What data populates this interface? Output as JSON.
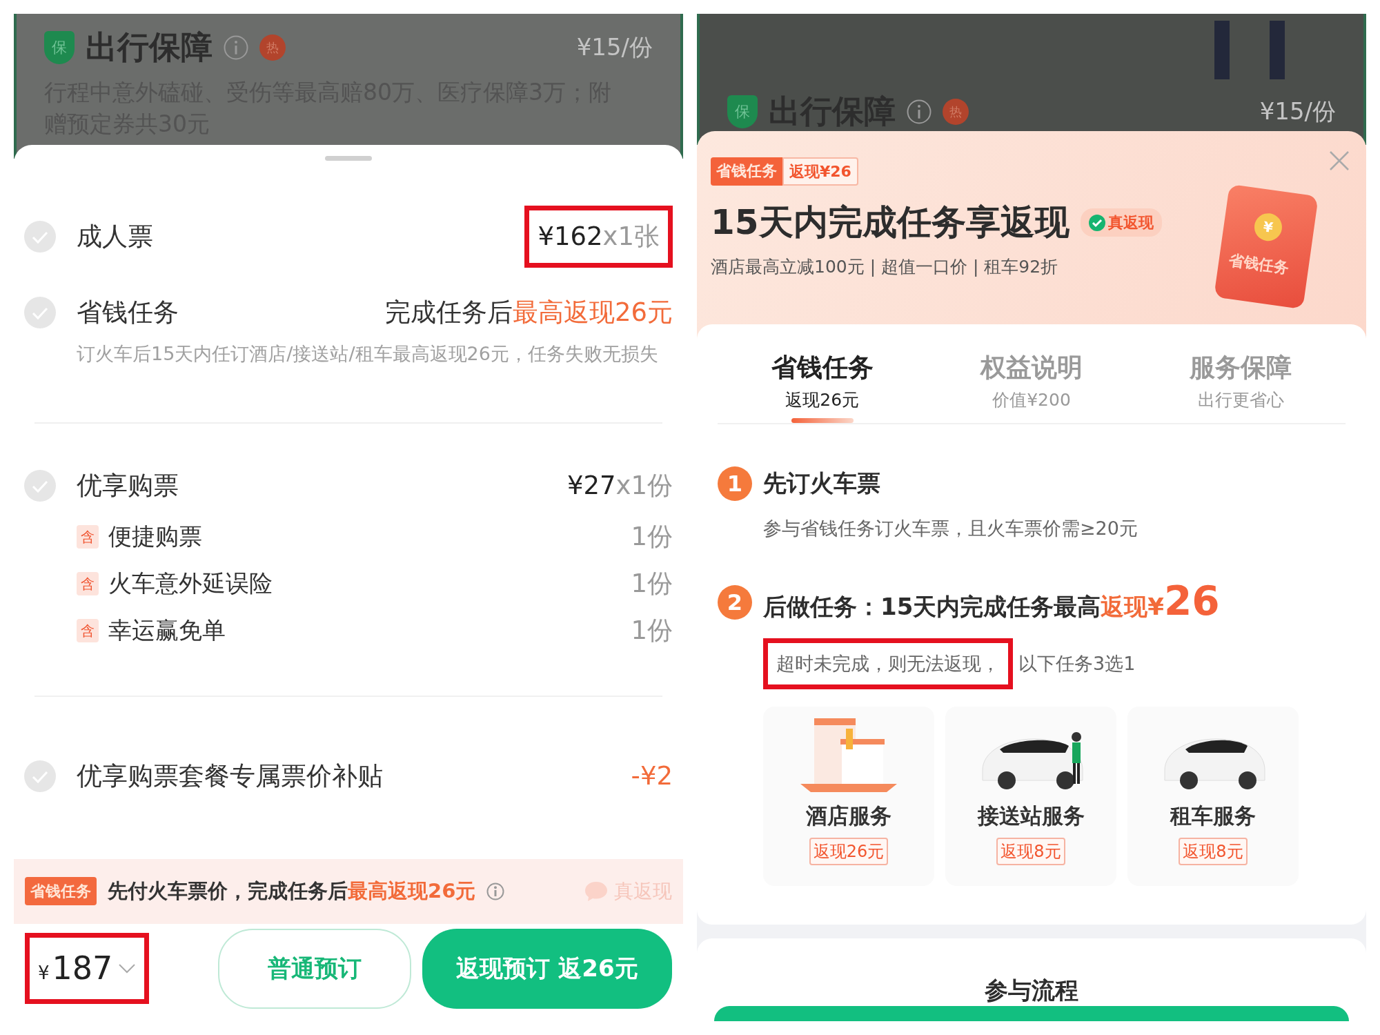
{
  "left_screen": {
    "background_card": {
      "shield": "保",
      "title": "出行保障",
      "badge": "热",
      "price": "¥15/份",
      "description": "行程中意外磕碰、受伤等最高赔80万、医疗保障3万；附赠预定券共30元"
    },
    "items": [
      {
        "kind": "line",
        "label": "成人票",
        "price": "¥162",
        "quantity": "x1张",
        "highlighted": true
      },
      {
        "kind": "task",
        "label": "省钱任务",
        "value": "完成任务后",
        "value_highlight": "最高返现26元",
        "note": "订火车后15天内任订酒店/接送站/租车最高返现26元，任务失败无损失"
      },
      {
        "kind": "package",
        "label": "优享购票",
        "price": "¥27",
        "quantity": "x1份",
        "includes": [
          {
            "tag": "含",
            "name": "便捷购票",
            "quantity": "1份"
          },
          {
            "tag": "含",
            "name": "火车意外延误险",
            "quantity": "1份"
          },
          {
            "tag": "含",
            "name": "幸运赢免单",
            "quantity": "1份"
          }
        ]
      },
      {
        "kind": "discount",
        "label": "优享购票套餐专属票价补贴",
        "amount": "-¥2"
      }
    ],
    "promo": {
      "tag": "省钱任务",
      "text": "先付火车票价，完成任务后",
      "highlight": "最高返现26元",
      "stamp": "真返现"
    },
    "footer": {
      "currency": "¥",
      "total": "187",
      "highlighted": true,
      "buttons": [
        {
          "kind": "outline",
          "label": "普通预订"
        },
        {
          "kind": "primary",
          "label": "返现预订 返26元"
        }
      ]
    }
  },
  "right_screen": {
    "background_card": {
      "shield": "保",
      "title": "出行保障",
      "badge": "热",
      "price": "¥15/份"
    },
    "header": {
      "tag": "省钱任务",
      "tag_value": "返现¥26",
      "title": "15天内完成任务享返现",
      "stamp": "真返现",
      "subtitle": "酒店最高立减100元 | 超值一口价 | 租车92折",
      "envelope_label": "省钱任务",
      "envelope_coin": "¥"
    },
    "tabs": [
      {
        "title": "省钱任务",
        "subtitle": "返现26元",
        "selected": true
      },
      {
        "title": "权益说明",
        "subtitle": "价值¥200",
        "selected": false
      },
      {
        "title": "服务保障",
        "subtitle": "出行更省心",
        "selected": false
      }
    ],
    "steps": [
      {
        "number": "1",
        "title": "先订火车票",
        "description": [
          {
            "text": "参与省钱任务订火车票，且火车票价需≥20元",
            "highlighted": false
          }
        ]
      },
      {
        "number": "2",
        "title": "后做任务：15天内完成任务最高",
        "title_highlight": "返现¥",
        "title_amount": "26",
        "description": [
          {
            "text": "超时未完成，则无法返现，",
            "highlighted": true
          },
          {
            "text": "以下任务3选1",
            "highlighted": false
          }
        ]
      }
    ],
    "services": [
      {
        "kind": "hotel",
        "name": "酒店服务",
        "reward": "返现26元"
      },
      {
        "kind": "shuttle",
        "name": "接送站服务",
        "reward": "返现8元"
      },
      {
        "kind": "rental",
        "name": "租车服务",
        "reward": "返现8元"
      }
    ],
    "next_section_title": "参与流程"
  }
}
